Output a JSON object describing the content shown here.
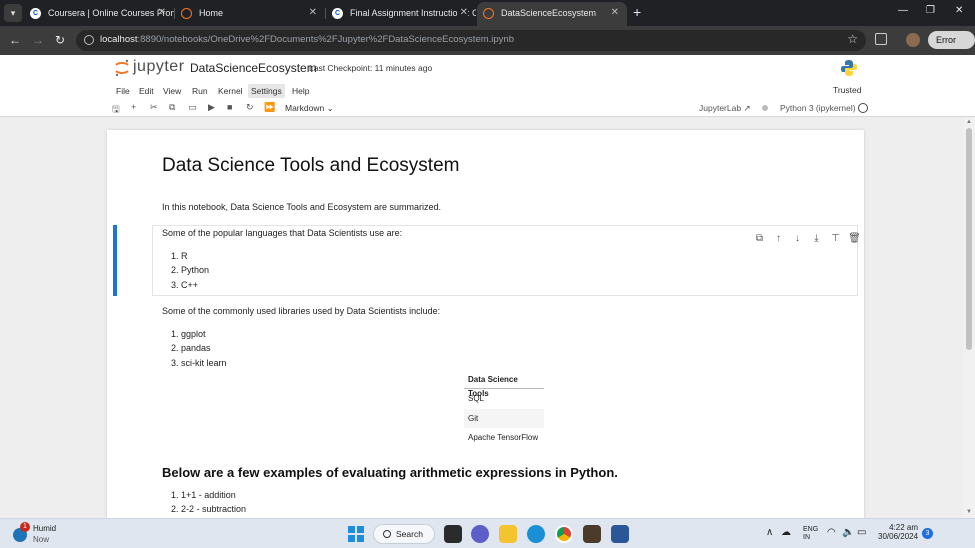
{
  "browser": {
    "tabs": [
      {
        "title": "Coursera | Online Courses Fron",
        "favicon": "coursera-icon",
        "active": false
      },
      {
        "title": "Home",
        "favicon": "jupyter-icon",
        "active": false
      },
      {
        "title": "Final Assignment Instructions: C",
        "favicon": "coursera-icon",
        "active": false
      },
      {
        "title": "DataScienceEcosystem",
        "favicon": "jupyter-icon",
        "active": true
      }
    ],
    "url_host": "localhost",
    "url_rest": ":8890/notebooks/OneDrive%2FDocuments%2FJupyter%2FDataScienceEcosystem.ipynb",
    "profile_label": "Error"
  },
  "jupyter": {
    "logo_text": "jupyter",
    "notebook_title": "DataScienceEcosystem",
    "checkpoint": "Last Checkpoint: 11 minutes ago",
    "menu": [
      "File",
      "Edit",
      "View",
      "Run",
      "Kernel",
      "Settings",
      "Help"
    ],
    "trusted": "Trusted",
    "cell_type": "Markdown",
    "jupyterlab_link": "JupyterLab",
    "kernel_name": "Python 3 (ipykernel)"
  },
  "notebook": {
    "title": "Data Science Tools and Ecosystem",
    "intro": "In this notebook, Data Science Tools and Ecosystem are summarized.",
    "languages_heading": "Some of the popular languages that Data Scientists use are:",
    "languages": [
      "R",
      "Python",
      "C++"
    ],
    "libraries_heading": "Some of the commonly used libraries used by Data Scientists include:",
    "libraries": [
      "ggplot",
      "pandas",
      "sci-kit learn"
    ],
    "tools_table": {
      "header": "Data Science Tools",
      "rows": [
        "SQL",
        "Git",
        "Apache TensorFlow"
      ]
    },
    "arith_heading": "Below are a few examples of evaluating arithmetic expressions in Python.",
    "arith_examples": [
      "1+1 - addition",
      "2-2 - subtraction"
    ]
  },
  "taskbar": {
    "weather_title": "Humid",
    "weather_sub": "Now",
    "weather_badge": "1",
    "search_label": "Search",
    "lang": "ENG",
    "lang_sub": "IN",
    "time": "4:22 am",
    "date": "30/06/2024",
    "notifications": "3"
  }
}
